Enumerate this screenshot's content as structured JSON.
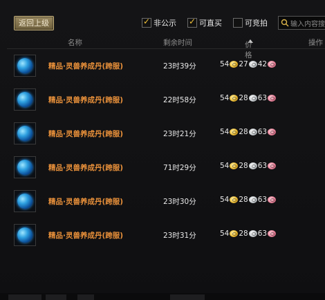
{
  "toolbar": {
    "back_label": "返回上级",
    "filters": [
      {
        "label": "非公示",
        "checked": true
      },
      {
        "label": "可直买",
        "checked": true
      },
      {
        "label": "可竞拍",
        "checked": false
      }
    ],
    "search_placeholder": "输入内容搜"
  },
  "table": {
    "headers": {
      "name": "名称",
      "time": "剩余时间",
      "price": "价格",
      "action": "操作"
    },
    "sort": {
      "column": "price",
      "direction": "ascending"
    },
    "rows": [
      {
        "name": "精品·灵兽养成丹(跨服)",
        "time": "23时39分",
        "gold": "54",
        "silver": "27",
        "copper": "42"
      },
      {
        "name": "精品·灵兽养成丹(跨服)",
        "time": "22时58分",
        "gold": "54",
        "silver": "28",
        "copper": "63"
      },
      {
        "name": "精品·灵兽养成丹(跨服)",
        "time": "23时21分",
        "gold": "54",
        "silver": "28",
        "copper": "63"
      },
      {
        "name": "精品·灵兽养成丹(跨服)",
        "time": "71时29分",
        "gold": "54",
        "silver": "28",
        "copper": "63"
      },
      {
        "name": "精品·灵兽养成丹(跨服)",
        "time": "23时30分",
        "gold": "54",
        "silver": "28",
        "copper": "63"
      },
      {
        "name": "精品·灵兽养成丹(跨服)",
        "time": "23时31分",
        "gold": "54",
        "silver": "28",
        "copper": "63"
      }
    ]
  },
  "colors": {
    "item_name": "#e8903a",
    "button_gold": "#9a8a62",
    "checkmark": "#f3c33a"
  },
  "icons": {
    "item": "blue-orb-pill-icon",
    "currency": [
      "gold-coin-icon",
      "silver-coin-icon",
      "copper-coin-icon"
    ],
    "search": "search-icon"
  }
}
